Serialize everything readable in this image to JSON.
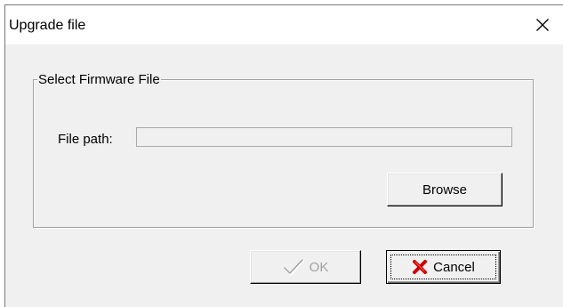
{
  "window": {
    "title": "Upgrade file",
    "close_icon": "close-icon"
  },
  "group": {
    "legend": "Select Firmware File"
  },
  "file_path": {
    "label": "File path:",
    "value": "",
    "enabled": false
  },
  "buttons": {
    "browse_label": "Browse",
    "ok_label": "OK",
    "ok_enabled": false,
    "ok_icon": "checkmark-icon",
    "cancel_label": "Cancel",
    "cancel_icon": "red-x-icon"
  },
  "colors": {
    "dialog_bg": "#f0f0f0",
    "titlebar_bg": "#ffffff",
    "disabled_text": "#a0a0a0",
    "cancel_icon": "#cc0000"
  }
}
